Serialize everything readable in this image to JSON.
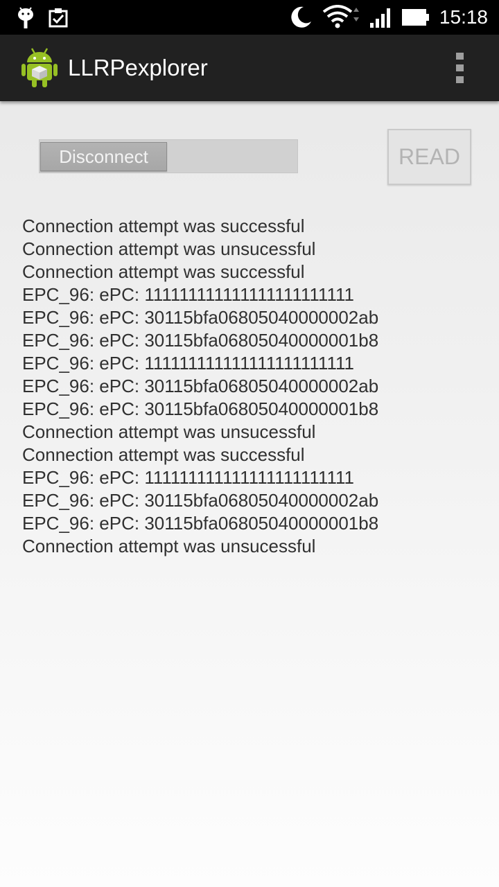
{
  "status_bar": {
    "time": "15:18",
    "icons": [
      "android-debug-icon",
      "clipboard-check-icon",
      "moon-icon",
      "wifi-icon",
      "signal-icon",
      "battery-icon"
    ]
  },
  "action_bar": {
    "title": "LLRPexplorer",
    "app_icon": "android-robot-icon",
    "menu_icon": "overflow-menu-icon"
  },
  "controls": {
    "toggle_label": "Disconnect",
    "read_label": "READ"
  },
  "log_lines": [
    "Connection attempt was successful",
    "Connection attempt was unsucessful",
    "Connection attempt was successful",
    "EPC_96: ePC: 111111111111111111111111",
    "EPC_96: ePC: 30115bfa06805040000002ab",
    "EPC_96: ePC: 30115bfa06805040000001b8",
    "EPC_96: ePC: 111111111111111111111111",
    "EPC_96: ePC: 30115bfa06805040000002ab",
    "EPC_96: ePC: 30115bfa06805040000001b8",
    "Connection attempt was unsucessful",
    "Connection attempt was successful",
    "EPC_96: ePC: 111111111111111111111111",
    "EPC_96: ePC: 30115bfa06805040000002ab",
    "EPC_96: ePC: 30115bfa06805040000001b8",
    "Connection attempt was unsucessful"
  ],
  "colors": {
    "status_bar": "#000000",
    "action_bar": "#212121",
    "android_green": "#97c024"
  }
}
